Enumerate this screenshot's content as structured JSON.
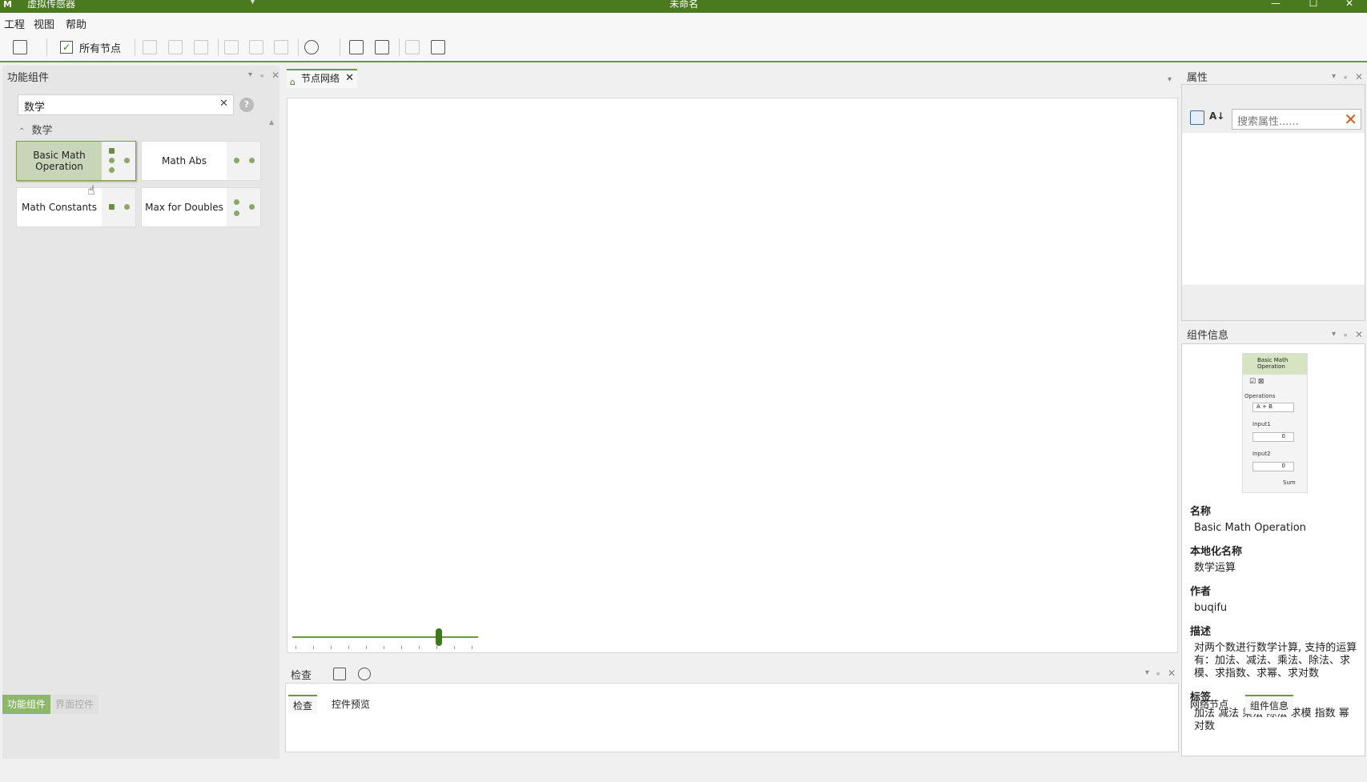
{
  "titlebar": {
    "app_name": "虚拟传感器",
    "title": "未命名",
    "min": "—",
    "max": "☐",
    "close": "✕"
  },
  "menu": {
    "project": "工程",
    "view": "视图",
    "help": "帮助"
  },
  "toolbar": {
    "all_nodes_label": "所有节点"
  },
  "left_panel": {
    "title": "功能组件",
    "search_value": "数学",
    "group": "数学",
    "nodes": [
      {
        "label": "Basic Math Operation"
      },
      {
        "label": "Math Abs"
      },
      {
        "label": "Math Constants"
      },
      {
        "label": "Max for Doubles"
      }
    ],
    "bottom_tabs": [
      "功能组件",
      "界面控件"
    ]
  },
  "center": {
    "tab_label": "节点网络",
    "zoom_percent": 79,
    "inspect_title": "检查",
    "bottom_tabs": [
      "检查",
      "控件预览"
    ]
  },
  "properties": {
    "title": "属性",
    "search_placeholder": "搜索属性......"
  },
  "component_info": {
    "title": "组件信息",
    "mini": {
      "header": "Basic Math Operation",
      "operations": "Operations",
      "op_value": "A + B",
      "input1": "Input1",
      "input1_val": "0",
      "input2": "Input2",
      "input2_val": "0",
      "sum": "Sum"
    },
    "name_k": "名称",
    "name_v": "Basic Math Operation",
    "loc_k": "本地化名称",
    "loc_v": "数学运算",
    "author_k": "作者",
    "author_v": "buqifu",
    "desc_k": "描述",
    "desc_v": "对两个数进行数学计算, 支持的运算有：加法、减法、乘法、除法、求模、求指数、求幂、求对数",
    "tags_k": "标签",
    "tags_v": "加法 减法 乘法 除法 求模 指数 幂 对数"
  },
  "right_bottom_tabs": [
    "网络节点",
    "组件信息"
  ],
  "colors": {
    "accent": "#4a7a1f",
    "accent_light": "#6b9a3c"
  }
}
